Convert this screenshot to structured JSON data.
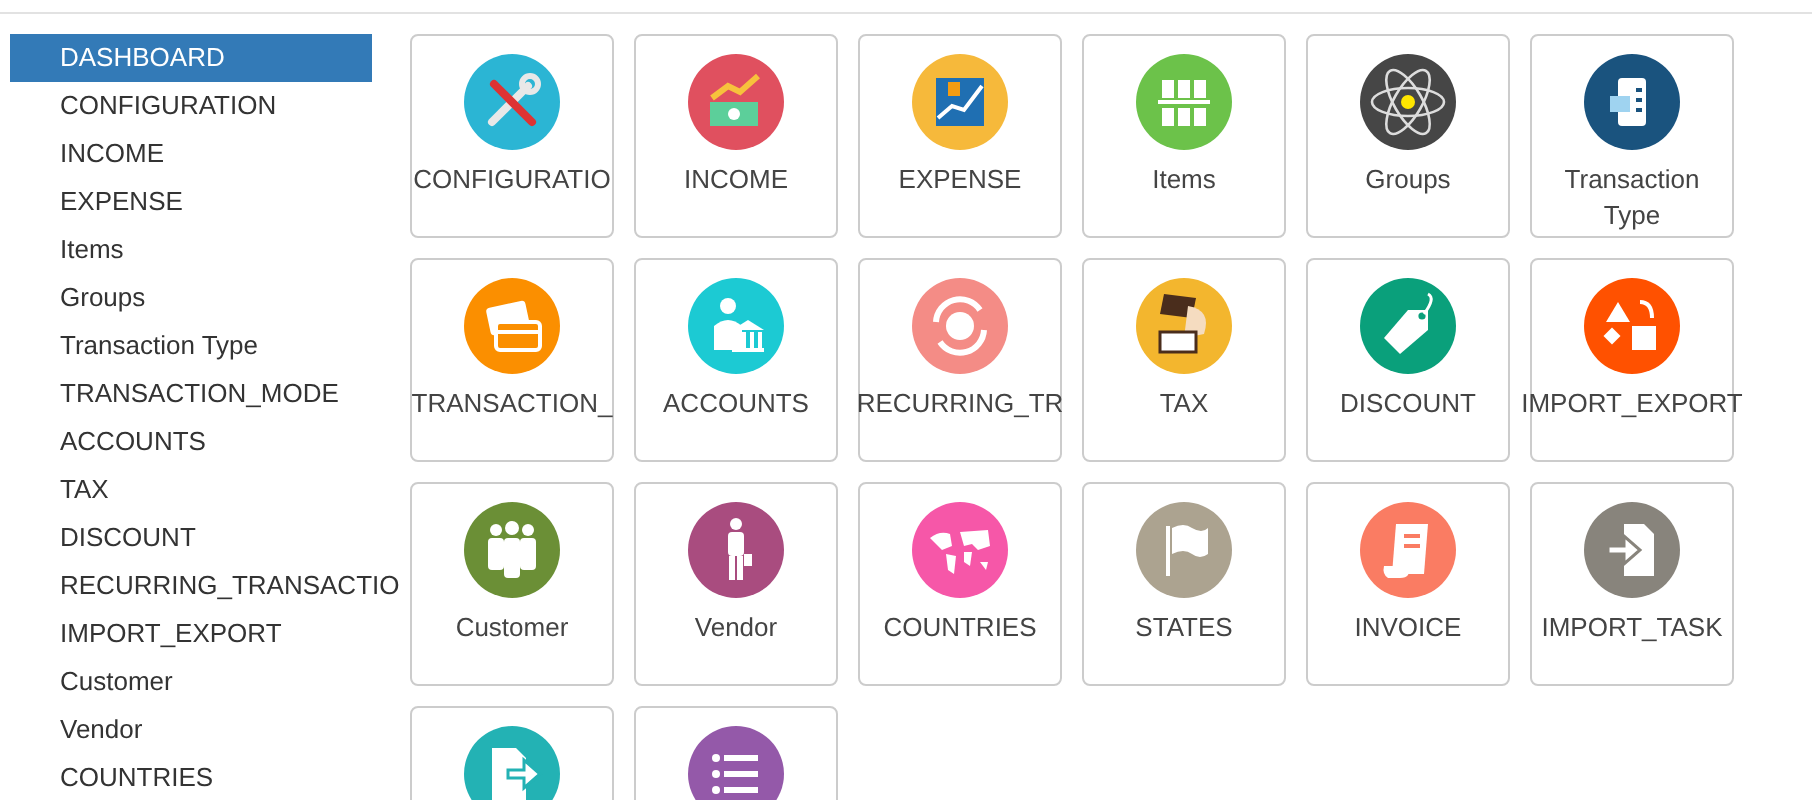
{
  "sidebar": {
    "items": [
      {
        "label": "DASHBOARD",
        "selected": true
      },
      {
        "label": "CONFIGURATION",
        "selected": false
      },
      {
        "label": "INCOME",
        "selected": false
      },
      {
        "label": "EXPENSE",
        "selected": false
      },
      {
        "label": "Items",
        "selected": false
      },
      {
        "label": "Groups",
        "selected": false
      },
      {
        "label": "Transaction Type",
        "selected": false
      },
      {
        "label": "TRANSACTION_MODE",
        "selected": false
      },
      {
        "label": "ACCOUNTS",
        "selected": false
      },
      {
        "label": "TAX",
        "selected": false
      },
      {
        "label": "DISCOUNT",
        "selected": false
      },
      {
        "label": "RECURRING_TRANSACTIO",
        "selected": false
      },
      {
        "label": "IMPORT_EXPORT",
        "selected": false
      },
      {
        "label": "Customer",
        "selected": false
      },
      {
        "label": "Vendor",
        "selected": false
      },
      {
        "label": "COUNTRIES",
        "selected": false
      }
    ]
  },
  "tiles": [
    {
      "label": "CONFIGURATIO",
      "kind": "tools",
      "color": "#2bb5d4"
    },
    {
      "label": "INCOME",
      "kind": "money",
      "color": "#e0505f"
    },
    {
      "label": "EXPENSE",
      "kind": "chart",
      "color": "#f6b93b"
    },
    {
      "label": "Items",
      "kind": "grid",
      "color": "#6cc24a"
    },
    {
      "label": "Groups",
      "kind": "atom",
      "color": "#464646"
    },
    {
      "label": "Transaction Type",
      "kind": "printer",
      "color": "#1a537e"
    },
    {
      "label": "TRANSACTION_",
      "kind": "cards",
      "color": "#fb8f00"
    },
    {
      "label": "ACCOUNTS",
      "kind": "bank",
      "color": "#1ccad3"
    },
    {
      "label": "RECURRING_TR",
      "kind": "cycle",
      "color": "#f48c86"
    },
    {
      "label": "TAX",
      "kind": "tag",
      "color": "#f3b62e"
    },
    {
      "label": "DISCOUNT",
      "kind": "percent",
      "color": "#0aa07b"
    },
    {
      "label": "IMPORT_EXPORT",
      "kind": "shapes",
      "color": "#ff5100"
    },
    {
      "label": "Customer",
      "kind": "people",
      "color": "#6b8f36"
    },
    {
      "label": "Vendor",
      "kind": "person",
      "color": "#a94c7f"
    },
    {
      "label": "COUNTRIES",
      "kind": "globe",
      "color": "#f657a8"
    },
    {
      "label": "STATES",
      "kind": "flag",
      "color": "#aca390"
    },
    {
      "label": "INVOICE",
      "kind": "receipt",
      "color": "#fa7c63"
    },
    {
      "label": "IMPORT_TASK",
      "kind": "import",
      "color": "#88847c"
    },
    {
      "kind": "export",
      "color": "#23b2b4"
    },
    {
      "kind": "list",
      "color": "#9459a9"
    }
  ]
}
